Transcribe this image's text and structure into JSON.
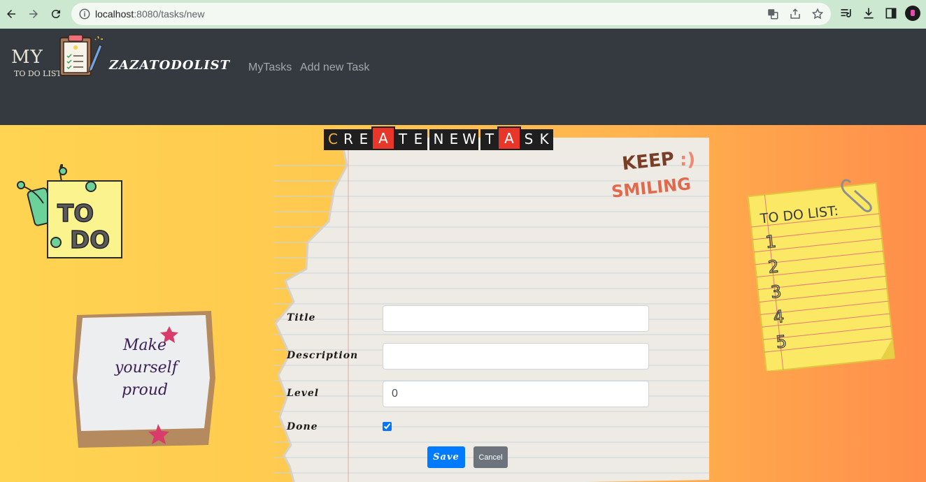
{
  "browser": {
    "url_host": "localhost",
    "url_path": ":8080/tasks/new"
  },
  "navbar": {
    "logo_text": "MY",
    "logo_subtext": "TO DO LIST",
    "brand": "ZAZATODOLIST",
    "links": [
      {
        "label": "MyTasks"
      },
      {
        "label": "Add new Task"
      }
    ]
  },
  "page": {
    "heading_words": [
      [
        "C",
        "R",
        "E",
        "A"
      ],
      [
        "A",
        "T",
        "E"
      ],
      [
        "N",
        "E",
        "W"
      ],
      [
        "T",
        "A",
        "S",
        "K"
      ]
    ],
    "heading": "CREATE NEW TASK",
    "sticker_keep": "KEEP",
    "sticker_smiling": "SMILING",
    "sticker_smile_face": ":)",
    "todo_sticker_line1": "TO",
    "todo_sticker_line2": "DO",
    "note_line1": "Make",
    "note_line2": "yourself",
    "note_line3": "proud",
    "list_title": "TO DO LIST:",
    "list_numbers": [
      "1",
      "2",
      "3",
      "4",
      "5"
    ]
  },
  "form": {
    "title_label": "Title",
    "title_value": "",
    "description_label": "Description",
    "description_value": "",
    "level_label": "Level",
    "level_value": "0",
    "done_label": "Done",
    "done_checked": true,
    "save_label": "Save",
    "cancel_label": "Cancel"
  },
  "colors": {
    "navbar": "#343a40",
    "tile_red": "#e8362a",
    "tile_text": "#f4b43b",
    "save": "#007bff",
    "cancel": "#6c757d"
  }
}
